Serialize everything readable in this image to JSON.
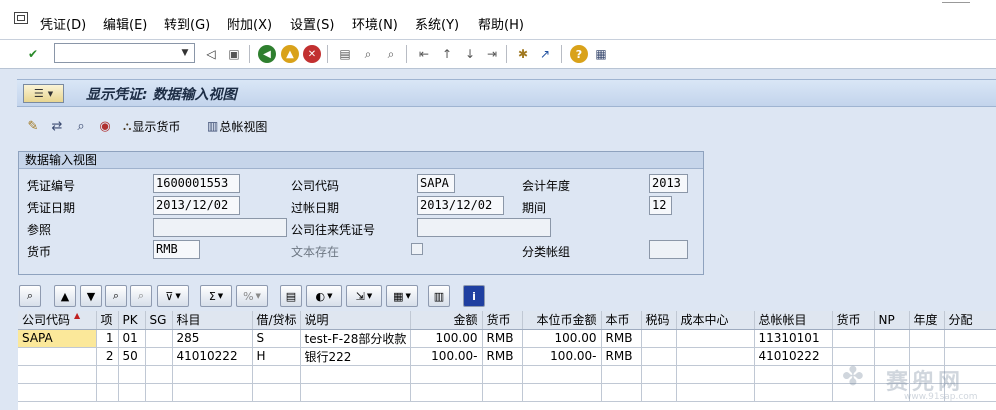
{
  "menu": {
    "items": [
      "凭证(D)",
      "编辑(E)",
      "转到(G)",
      "附加(X)",
      "设置(S)",
      "环境(N)",
      "系统(Y)",
      "帮助(H)"
    ]
  },
  "toolbar": {
    "command_field_value": "",
    "icons": [
      "enter-icon",
      "back-icon",
      "save-icon",
      "back-green-icon",
      "exit-icon",
      "cancel-icon",
      "print-icon",
      "find-icon",
      "find-next-icon",
      "first-page-icon",
      "previous-page-icon",
      "next-page-icon",
      "last-page-icon",
      "create-session-icon",
      "shortcut-icon",
      "help-icon",
      "customize-layout-icon"
    ]
  },
  "title": {
    "text": "显示凭证: 数据输入视图"
  },
  "app_toolbar": {
    "display_currency_label": "显示货币",
    "general_ledger_view_label": "总帐视图"
  },
  "header_section": {
    "title": "数据输入视图",
    "fields": {
      "doc_number": {
        "label": "凭证编号",
        "value": "1600001553"
      },
      "company_code": {
        "label": "公司代码",
        "value": "SAPA"
      },
      "fiscal_year": {
        "label": "会计年度",
        "value": "2013"
      },
      "doc_date": {
        "label": "凭证日期",
        "value": "2013/12/02"
      },
      "posting_date": {
        "label": "过帐日期",
        "value": "2013/12/02"
      },
      "period": {
        "label": "期间",
        "value": "12"
      },
      "reference": {
        "label": "参照",
        "value": ""
      },
      "cross_cc_number": {
        "label": "公司往来凭证号",
        "value": ""
      },
      "currency": {
        "label": "货币",
        "value": "RMB"
      },
      "text_exists": {
        "label": "文本存在",
        "checked": false
      },
      "ledger_group": {
        "label": "分类帐组",
        "value": ""
      }
    }
  },
  "alv_toolbar": {
    "info_icon": "i"
  },
  "table": {
    "columns": [
      "公司代码",
      "项",
      "PK",
      "SG",
      "科目",
      "借/贷标",
      "说明",
      "金额",
      "货币",
      "本位币金额",
      "本币",
      "税码",
      "成本中心",
      "总帐帐目",
      "货币",
      "NP",
      "年度",
      "分配"
    ],
    "rows": [
      [
        "SAPA",
        "1",
        "01",
        "",
        "285",
        "S",
        "test-F-28部分收款",
        "100.00",
        "RMB",
        "100.00",
        "RMB",
        "",
        "",
        "11310101",
        "",
        "",
        "",
        ""
      ],
      [
        "",
        "2",
        "50",
        "",
        "41010222",
        "H",
        "银行222",
        "100.00-",
        "RMB",
        "100.00-",
        "RMB",
        "",
        "",
        "41010222",
        "",
        "",
        "",
        ""
      ]
    ]
  },
  "watermark": {
    "text": "赛兜网",
    "url": "www.91sap.com"
  }
}
